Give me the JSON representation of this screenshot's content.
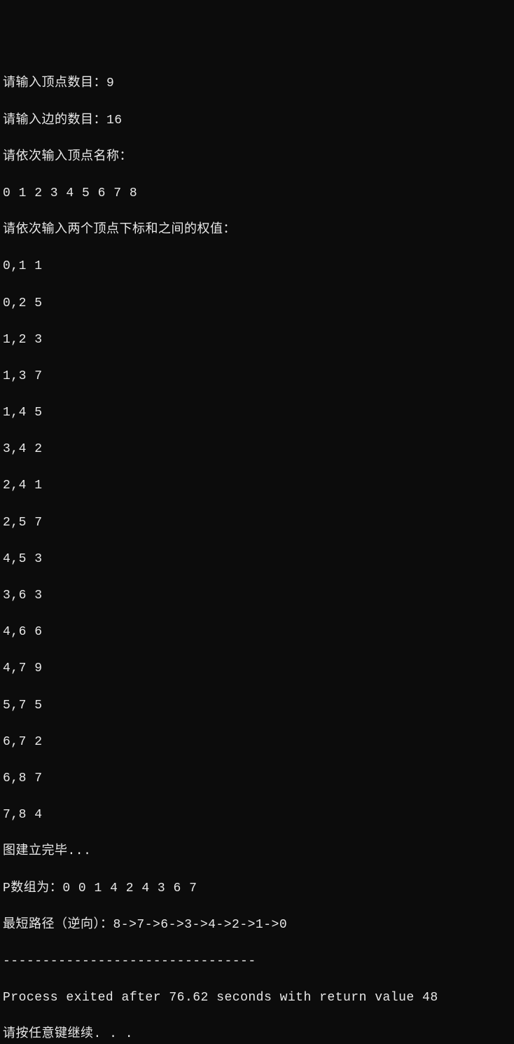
{
  "prompts": {
    "vertex_count_label": "请输入顶点数目：",
    "vertex_count_value": "9",
    "edge_count_label": "请输入边的数目：",
    "edge_count_value": "16",
    "vertex_names_label": "请依次输入顶点名称：",
    "vertex_names_value": "0 1 2 3 4 5 6 7 8",
    "edge_input_label": "请依次输入两个顶点下标和之间的权值："
  },
  "edges": [
    "0,1 1",
    "0,2 5",
    "1,2 3",
    "1,3 7",
    "1,4 5",
    "3,4 2",
    "2,4 1",
    "2,5 7",
    "4,5 3",
    "3,6 3",
    "4,6 6",
    "4,7 9",
    "5,7 5",
    "6,7 2",
    "6,8 7",
    "7,8 4"
  ],
  "results": {
    "graph_built": "图建立完毕...",
    "p_array_label": "P数组为：",
    "p_array_value": "0 0 1 4 2 4 3 6 7",
    "shortest_path_label": "最短路径（逆向）：",
    "shortest_path_value": "8->7->6->3->4->2->1->0",
    "separator": "--------------------------------"
  },
  "footer": {
    "process_exit_prefix": "Process exited after ",
    "process_exit_seconds": "76.62",
    "process_exit_mid": " seconds with return value ",
    "process_exit_return": "48",
    "continue_prompt": "请按任意键继续. . ."
  }
}
